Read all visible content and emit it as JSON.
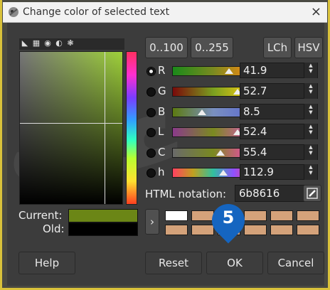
{
  "window": {
    "title": "Change color of selected text",
    "close_glyph": "×"
  },
  "modes": [
    "triangle-icon",
    "grid-icon",
    "circle-icon",
    "wheel-icon",
    "palette-icon"
  ],
  "range_buttons": {
    "r100": "0..100",
    "r255": "0..255"
  },
  "model_buttons": {
    "lch": "LCh",
    "hsv": "HSV"
  },
  "sliders": [
    {
      "label": "R",
      "value": "41.9",
      "selected": true
    },
    {
      "label": "G",
      "value": "52.7",
      "selected": false
    },
    {
      "label": "B",
      "value": "8.5",
      "selected": false
    },
    {
      "label": "L",
      "value": "52.4",
      "selected": false
    },
    {
      "label": "C",
      "value": "55.4",
      "selected": false
    },
    {
      "label": "h",
      "value": "112.9",
      "selected": false
    }
  ],
  "html": {
    "label": "HTML notation:",
    "value": "6b8616"
  },
  "swatches": {
    "current_label": "Current:",
    "old_label": "Old:",
    "current_color": "#6b8616",
    "old_color": "#000000"
  },
  "history_colors": [
    "#ffffff",
    "#d4a27a",
    "#d4a27a",
    "#d4a27a",
    "#d4a27a",
    "#d4a27a",
    "#d4a27a",
    "#d4a27a",
    "#d4a27a",
    "#d4a27a",
    "#d4a27a",
    "#d4a27a"
  ],
  "badge": {
    "number": "5",
    "color": "#1565c0"
  },
  "buttons": {
    "help": "Help",
    "reset": "Reset",
    "ok": "OK",
    "cancel": "Cancel"
  },
  "arrow_glyph": "›"
}
